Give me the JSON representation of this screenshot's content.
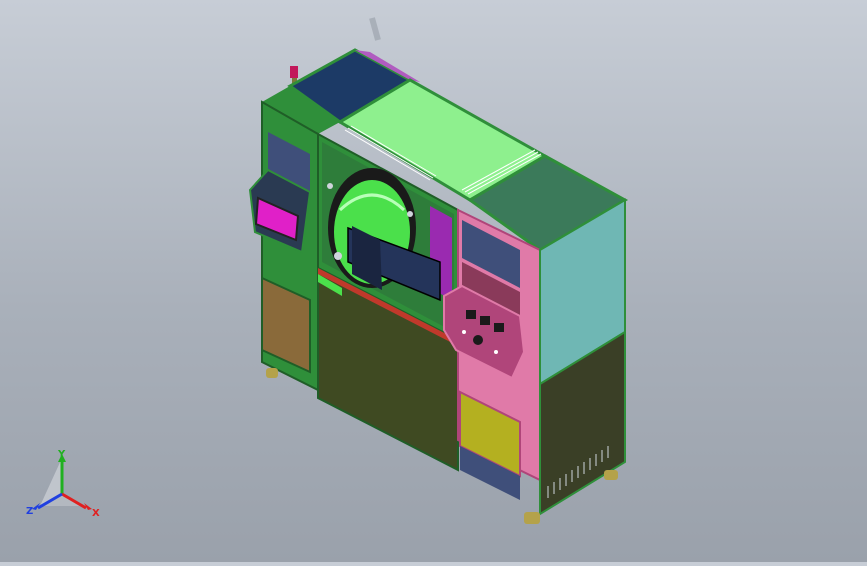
{
  "viewport": {
    "background": "#b4bac3"
  },
  "model": {
    "colors": {
      "frame": "#2f8f3a",
      "frame_dark": "#1f5e27",
      "top_panel": "#8ef08e",
      "top_left_panel": "#1c3a66",
      "left_cabinet": "#3f4f7a",
      "left_screen": "#e020c8",
      "left_screen_bezel": "#2a3a52",
      "lower_left": "#8a6a3a",
      "base_olive": "#3f4a22",
      "door_bg": "#2e7d3a",
      "dome": "#4be04b",
      "tray": "#24345a",
      "control_panel": "#b0457a",
      "control_frame": "#e07aa8",
      "yellow_panel": "#b4b020",
      "right_top": "#6fb7b4",
      "right_block": "#3b5a2e",
      "right_lower": "#3a3f26",
      "beacon": "#c2185b",
      "vent": "#ffffff"
    }
  },
  "triad": {
    "labels": {
      "x": "X",
      "y": "Y",
      "z": "Z"
    },
    "colors": {
      "x": "#e02020",
      "y": "#20b020",
      "z": "#2040e0"
    }
  }
}
